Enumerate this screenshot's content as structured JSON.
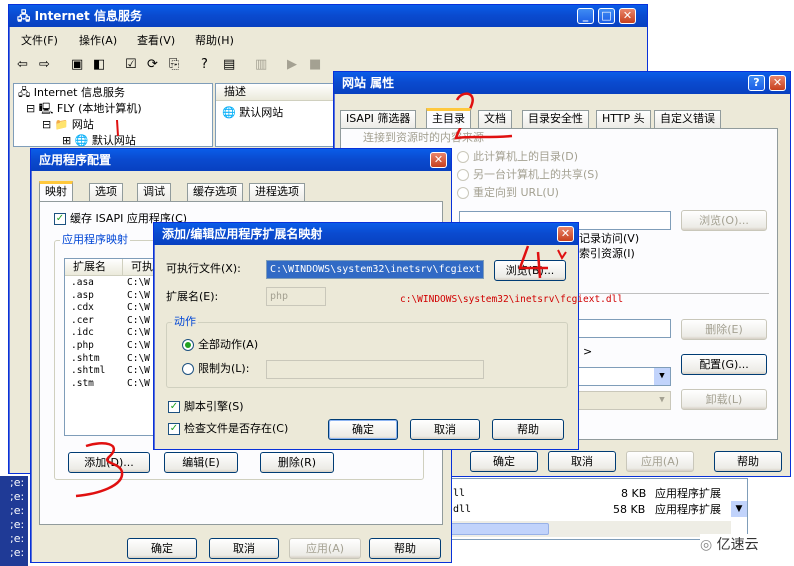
{
  "iis": {
    "title": "Internet 信息服务",
    "menu": [
      "文件(F)",
      "操作(A)",
      "查看(V)",
      "帮助(H)"
    ],
    "tree": [
      "Internet 信息服务",
      "FLY (本地计算机)",
      "网站",
      "默认网站"
    ],
    "col": "描述",
    "site": "默认网站",
    "taskbar": ";e:",
    "files": [
      {
        "name": "ll",
        "size": "8 KB",
        "type": "应用程序扩展"
      },
      {
        "name": "dll",
        "size": "58 KB",
        "type": "应用程序扩展"
      }
    ]
  },
  "props": {
    "title": "网站 属性",
    "tabs": [
      "ISAPI 筛选器",
      "主目录",
      "文档",
      "目录安全性",
      "HTTP 头",
      "自定义错误"
    ],
    "desc": "连接到资源时的内容来源",
    "opt": [
      "此计算机上的目录(D)",
      "另一台计算机上的共享(S)",
      "重定向到 URL(U)"
    ],
    "browse": "浏览(O)...",
    "log": "记录访问(V)",
    "index": "索引资源(I)",
    "remove": "删除(E)",
    "config": "配置(G)...",
    "unload": "卸载(L)",
    "ok": "确定",
    "cancel": "取消",
    "apply": "应用(A)",
    "help": "帮助"
  },
  "appcfg": {
    "title": "应用程序配置",
    "tabs": [
      "映射",
      "选项",
      "调试",
      "缓存选项",
      "进程选项"
    ],
    "cache": "缓存 ISAPI 应用程序(C)",
    "group": "应用程序映射",
    "cols": [
      "扩展名",
      "可执"
    ],
    "rows": [
      {
        "ext": ".asa",
        "path": "C:\\W"
      },
      {
        "ext": ".asp",
        "path": "C:\\W"
      },
      {
        "ext": ".cdx",
        "path": "C:\\W"
      },
      {
        "ext": ".cer",
        "path": "C:\\W"
      },
      {
        "ext": ".idc",
        "path": "C:\\W"
      },
      {
        "ext": ".php",
        "path": "C:\\W"
      },
      {
        "ext": ".shtm",
        "path": "C:\\W"
      },
      {
        "ext": ".shtml",
        "path": "C:\\W"
      },
      {
        "ext": ".stm",
        "path": "C:\\W"
      }
    ],
    "add": "添加(D)...",
    "edit": "编辑(E)",
    "remove": "删除(R)",
    "ok": "确定",
    "cancel": "取消",
    "apply": "应用(A)",
    "help": "帮助"
  },
  "dlg": {
    "title": "添加/编辑应用程序扩展名映射",
    "exe_label": "可执行文件(X):",
    "exe_value": "C:\\WINDOWS\\system32\\inetsrv\\fcgiext.",
    "browse": "浏览(B)...",
    "ext_label": "扩展名(E):",
    "ext_value": "php",
    "annot": "c:\\WINDOWS\\system32\\inetsrv\\fcgiext.dll",
    "actions": "动作",
    "all": "全部动作(A)",
    "limit": "限制为(L):",
    "script": "脚本引擎(S)",
    "verify": "检查文件是否存在(C)",
    "ok": "确定",
    "cancel": "取消",
    "help": "帮助"
  },
  "watermark": "亿速云"
}
